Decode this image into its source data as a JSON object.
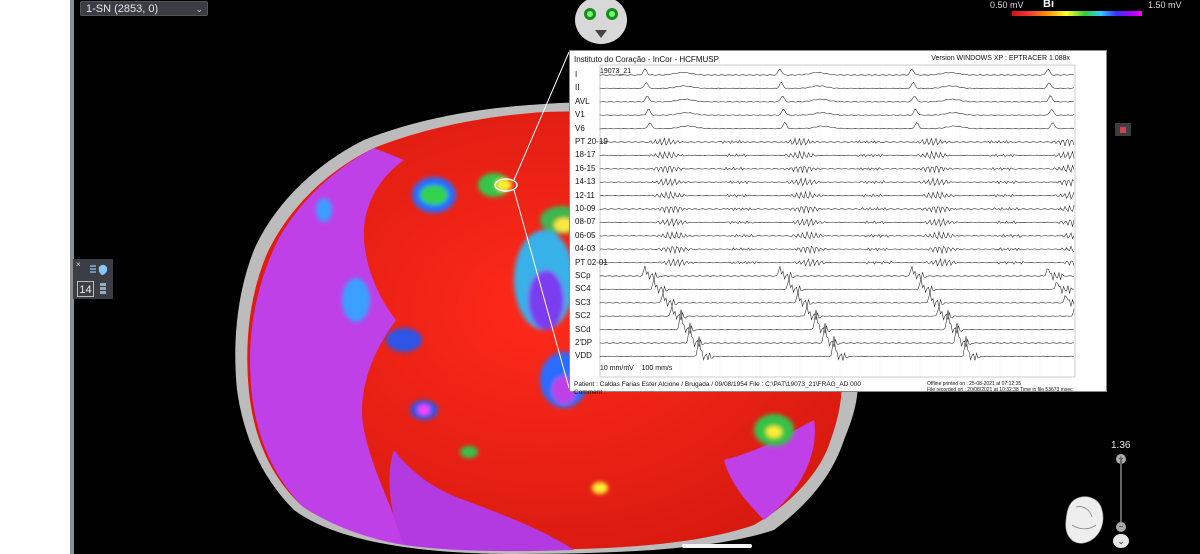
{
  "toolbar": {
    "map_selector": "1-SN (2853, 0)"
  },
  "color_scale": {
    "min": "0.50 mV",
    "mode": "Bi",
    "max": "1.50 mV",
    "colors": [
      "#cc1111",
      "#ff9900",
      "#ffff33",
      "#33cc33",
      "#33ccff",
      "#3333ff",
      "#aa00ff",
      "#ff00ff"
    ]
  },
  "side_tool": {
    "close": "×",
    "value": "14"
  },
  "zoom": {
    "value": "1.36",
    "plus": "+",
    "minus": "−"
  },
  "ecg": {
    "header": "Instituto do Coração - InCor - HCFMUSP",
    "version": "Version WINDOWS XP : EPTRACER 1.088x",
    "case_id": "19073_21",
    "leads": [
      "I",
      "II",
      "AVL",
      "V1",
      "V6",
      "PT 20-19",
      "18-17",
      "16-15",
      "14-13",
      "12-11",
      "10-09",
      "08-07",
      "06-05",
      "04-03",
      "PT 02-01",
      "SCp",
      "SC4",
      "SC3",
      "SC2",
      "SCd",
      "2'DP",
      "VDD"
    ],
    "scale": "10 mm/mV    100 mm/s",
    "patient": "Patient : Caldas Farias Ester Alcione / Brugada / 09/08/1954   File : C:\\PAT\\19073_21\\FRAG_AD 000",
    "comment": "Comment :",
    "offline": "Offline printed on : 25-08-2021 at 07:12:35",
    "recorded": "File recorded on : 20/08/2021 at 10:32:38  Time in file 53673 msec"
  }
}
